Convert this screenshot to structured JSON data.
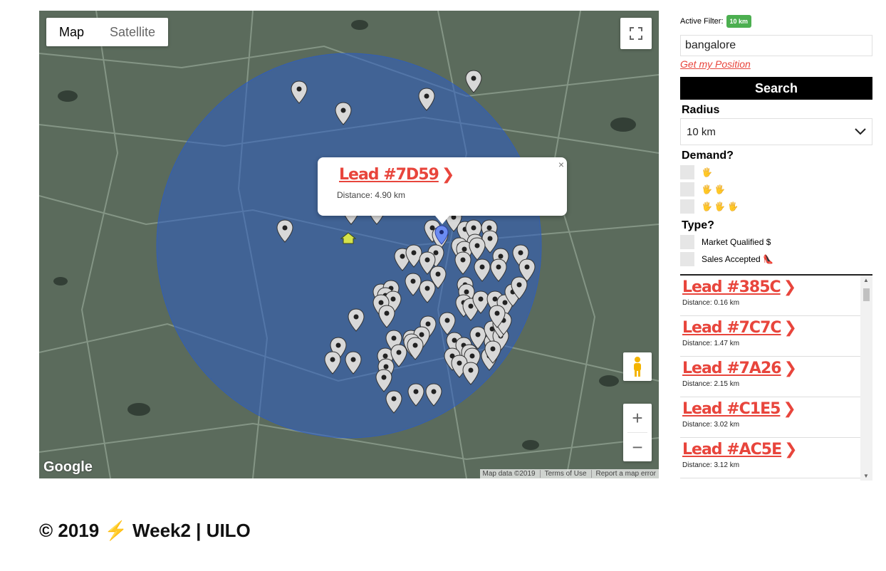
{
  "map": {
    "type_tabs": [
      "Map",
      "Satellite"
    ],
    "logo": "Google",
    "attribution": [
      "Map data ©2019",
      "Terms of Use",
      "Report a map error"
    ],
    "circle_color": "#2c5cc4",
    "zoom_in": "+",
    "zoom_out": "−",
    "infowindow": {
      "title": "Lead #7D59",
      "distance": "Distance: 4.90 km",
      "close": "×"
    }
  },
  "sidebar": {
    "active_filter_label": "Active Filter:",
    "active_filter_value": "10 km",
    "search_value": "bangalore",
    "get_position": "Get my Position",
    "search_button": "Search",
    "radius_label": "Radius",
    "radius_value": "10 km",
    "demand_label": "Demand?",
    "demand_options": [
      "🖐",
      "🖐 🖐",
      "🖐 🖐 🖐"
    ],
    "type_label": "Type?",
    "type_options": [
      "Market Qualified $",
      "Sales Accepted 👠"
    ]
  },
  "leads": [
    {
      "title": "Lead #385C",
      "distance": "Distance: 0.16 km"
    },
    {
      "title": "Lead #7C7C",
      "distance": "Distance: 1.47 km"
    },
    {
      "title": "Lead #7A26",
      "distance": "Distance: 2.15 km"
    },
    {
      "title": "Lead #C1E5",
      "distance": "Distance: 3.02 km"
    },
    {
      "title": "Lead #AC5E",
      "distance": "Distance: 3.12 km"
    }
  ],
  "footer": "© 2019 ⚡ Week2 | UILO"
}
